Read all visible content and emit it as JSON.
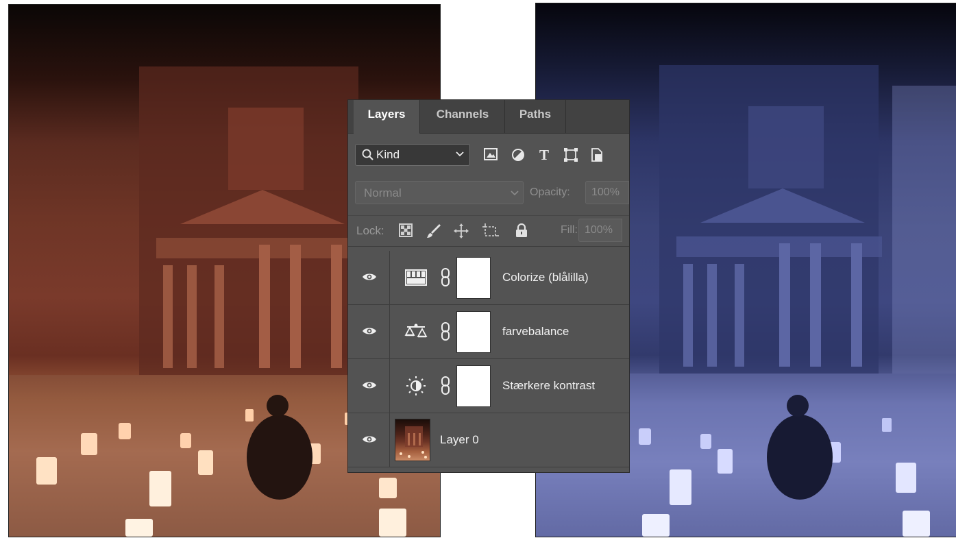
{
  "panel": {
    "tabs": [
      {
        "label": "Layers"
      },
      {
        "label": "Channels"
      },
      {
        "label": "Paths"
      }
    ],
    "filter": {
      "kind_label": "Kind",
      "icons": [
        "image-filter-icon",
        "adjustment-filter-icon",
        "type-filter-icon",
        "shape-filter-icon",
        "smart-object-filter-icon"
      ]
    },
    "blend": {
      "mode": "Normal",
      "opacity_label": "Opacity:",
      "opacity_value": "100%"
    },
    "lock": {
      "label": "Lock:",
      "icons": [
        "lock-transparent-icon",
        "lock-paint-icon",
        "lock-position-icon",
        "lock-artboard-icon",
        "lock-all-icon"
      ],
      "fill_label": "Fill:",
      "fill_value": "100%"
    },
    "layers": [
      {
        "name": "Colorize (blålilla)",
        "icon": "gradient-map-icon",
        "visible": true
      },
      {
        "name": "farvebalance",
        "icon": "color-balance-icon",
        "visible": true
      },
      {
        "name": "Stærkere kontrast",
        "icon": "brightness-contrast-icon",
        "visible": true
      },
      {
        "name": "Layer 0",
        "icon": "image-thumbnail",
        "visible": true
      }
    ]
  },
  "colors": {
    "panel_bg": "#535353",
    "tab_bar_bg": "#424242",
    "left_photo_tone": "#7a3a2b",
    "right_photo_tone": "#3e4780"
  }
}
